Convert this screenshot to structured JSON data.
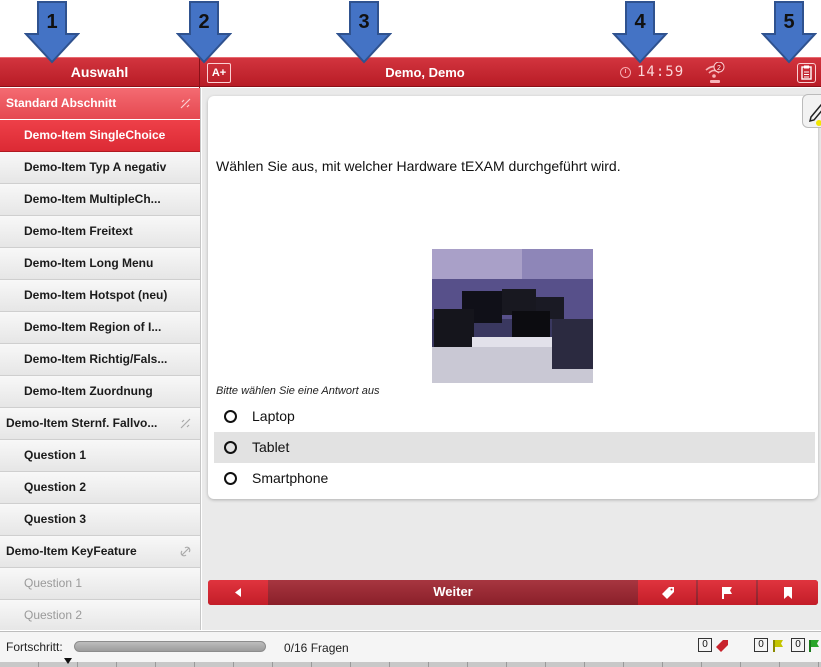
{
  "header": {
    "sidebar_title": "Auswahl",
    "font_size_button": "A+",
    "user_name": "Demo, Demo",
    "timer": "14:59",
    "network_badge": "2",
    "accent_color": "#c8232d"
  },
  "markers": [
    "1",
    "2",
    "3",
    "4",
    "5"
  ],
  "sidebar": {
    "sections": [
      {
        "label": "Standard Abschnitt",
        "items": [
          {
            "label": "Demo-Item SingleChoice",
            "state": "active"
          },
          {
            "label": "Demo-Item Typ A negativ"
          },
          {
            "label": "Demo-Item MultipleCh..."
          },
          {
            "label": "Demo-Item Freitext"
          },
          {
            "label": "Demo-Item Long Menu"
          },
          {
            "label": "Demo-Item Hotspot (neu)"
          },
          {
            "label": "Demo-Item Region of I..."
          },
          {
            "label": "Demo-Item Richtig/Fals..."
          },
          {
            "label": "Demo-Item Zuordnung"
          }
        ]
      }
    ],
    "groups": [
      {
        "label": "Demo-Item Sternf. Fallvo...",
        "questions": [
          "Question 1",
          "Question 2",
          "Question 3"
        ]
      },
      {
        "label": "Demo-Item KeyFeature",
        "questions": [
          "Question 1",
          "Question 2"
        ]
      }
    ]
  },
  "question": {
    "text": "Wählen Sie aus, mit welcher Hardware tEXAM durchgeführt wird.",
    "prompt": "Bitte wählen Sie eine Antwort aus",
    "answers": [
      "Laptop",
      "Tablet",
      "Smartphone"
    ]
  },
  "navbar": {
    "next_label": "Weiter",
    "buttons": [
      "back-icon",
      "tag-icon",
      "flag-icon",
      "bookmark-icon"
    ]
  },
  "footer": {
    "progress_label": "Fortschritt:",
    "progress_fraction": 0,
    "progress_count": "0/16 Fragen",
    "tag_count": "0",
    "flag_count": "0",
    "bookmark_count": "0"
  }
}
